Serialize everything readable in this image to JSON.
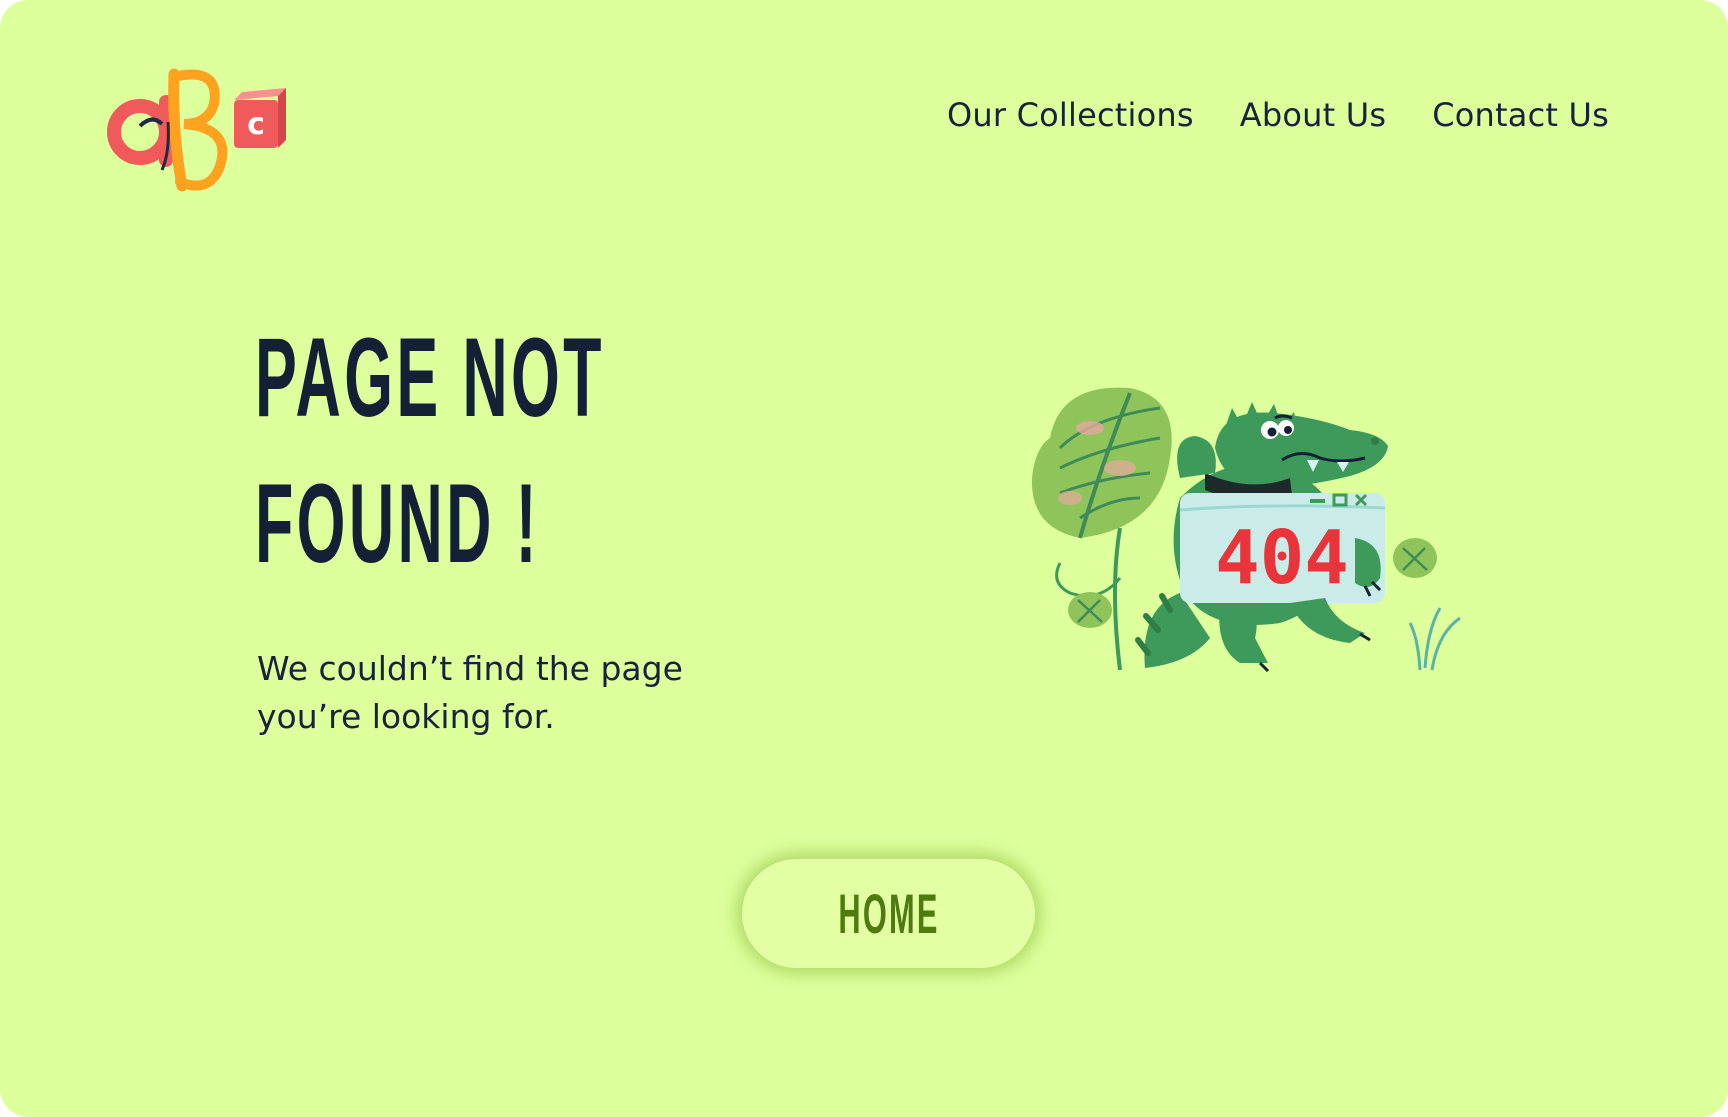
{
  "logo": {
    "letters": "aBc",
    "colors": {
      "a": "#f05a5a",
      "b": "#ffa21f",
      "c_block": "#f0585c"
    }
  },
  "nav": {
    "items": [
      {
        "label": "Our Collections"
      },
      {
        "label": "About Us"
      },
      {
        "label": "Contact Us"
      }
    ]
  },
  "error": {
    "title_line1": "PAGE NOT",
    "title_line2": "FOUND !",
    "message_line1": "We couldn’t find the page",
    "message_line2": "you’re looking for."
  },
  "illustration": {
    "icon": "crocodile-404-illustration",
    "code": "404"
  },
  "home_button": {
    "label": "HOME"
  },
  "colors": {
    "background": "#ddff9c",
    "text": "#16233a",
    "button_text": "#4e7a10",
    "accent_red": "#e8343a"
  }
}
